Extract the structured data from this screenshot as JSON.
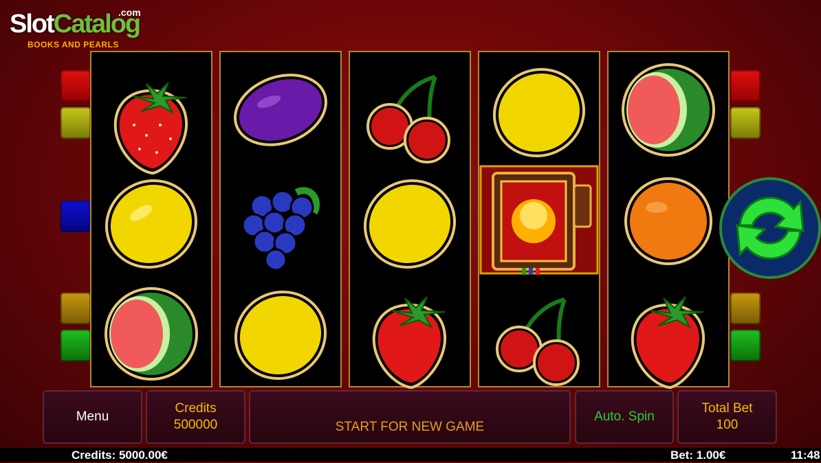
{
  "logo": {
    "brand_part1": "Slot",
    "brand_part2": "Catalog",
    "brand_tld": ".com",
    "game_title": "BOOKS AND PEARLS"
  },
  "colors": {
    "frame_gold": "#b08a2a",
    "label_gold": "#f0c000",
    "label_green": "#2ecc3a",
    "bg_red": "#7a0a0c"
  },
  "reels": [
    [
      "strawberry",
      "lemon",
      "watermelon"
    ],
    [
      "plum",
      "grapes",
      "lemon"
    ],
    [
      "cherries",
      "lemon",
      "strawberry"
    ],
    [
      "lemon",
      "book-of-pearls",
      "cherries"
    ],
    [
      "watermelon",
      "orange",
      "strawberry"
    ]
  ],
  "spin_button": {
    "icon": "refresh-arrows-icon"
  },
  "panel": {
    "menu_label": "Menu",
    "credits_label": "Credits",
    "credits_value": "500000",
    "message": "START FOR NEW GAME",
    "autospin_label": "Auto. Spin",
    "totalbet_label": "Total Bet",
    "totalbet_value": "100"
  },
  "status": {
    "credits": "Credits: 5000.00€",
    "bet": "Bet: 1.00€",
    "time": "11:48"
  }
}
